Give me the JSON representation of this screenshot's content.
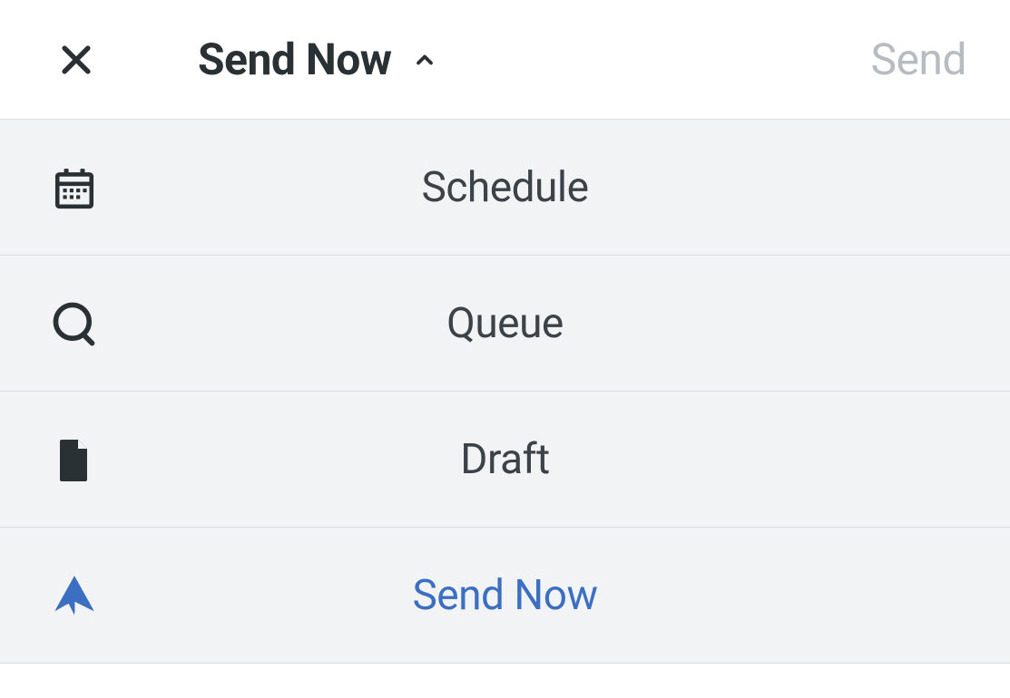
{
  "header": {
    "title": "Send Now",
    "send_label": "Send"
  },
  "menu": {
    "items": [
      {
        "label": "Schedule",
        "icon": "calendar",
        "selected": false
      },
      {
        "label": "Queue",
        "icon": "queue",
        "selected": false
      },
      {
        "label": "Draft",
        "icon": "file",
        "selected": false
      },
      {
        "label": "Send Now",
        "icon": "send",
        "selected": true
      }
    ]
  },
  "colors": {
    "accent": "#3c6fc1",
    "text": "#2a3135",
    "muted": "#b6bcc1",
    "panel": "#f2f3f4",
    "border": "#d9dde0"
  }
}
